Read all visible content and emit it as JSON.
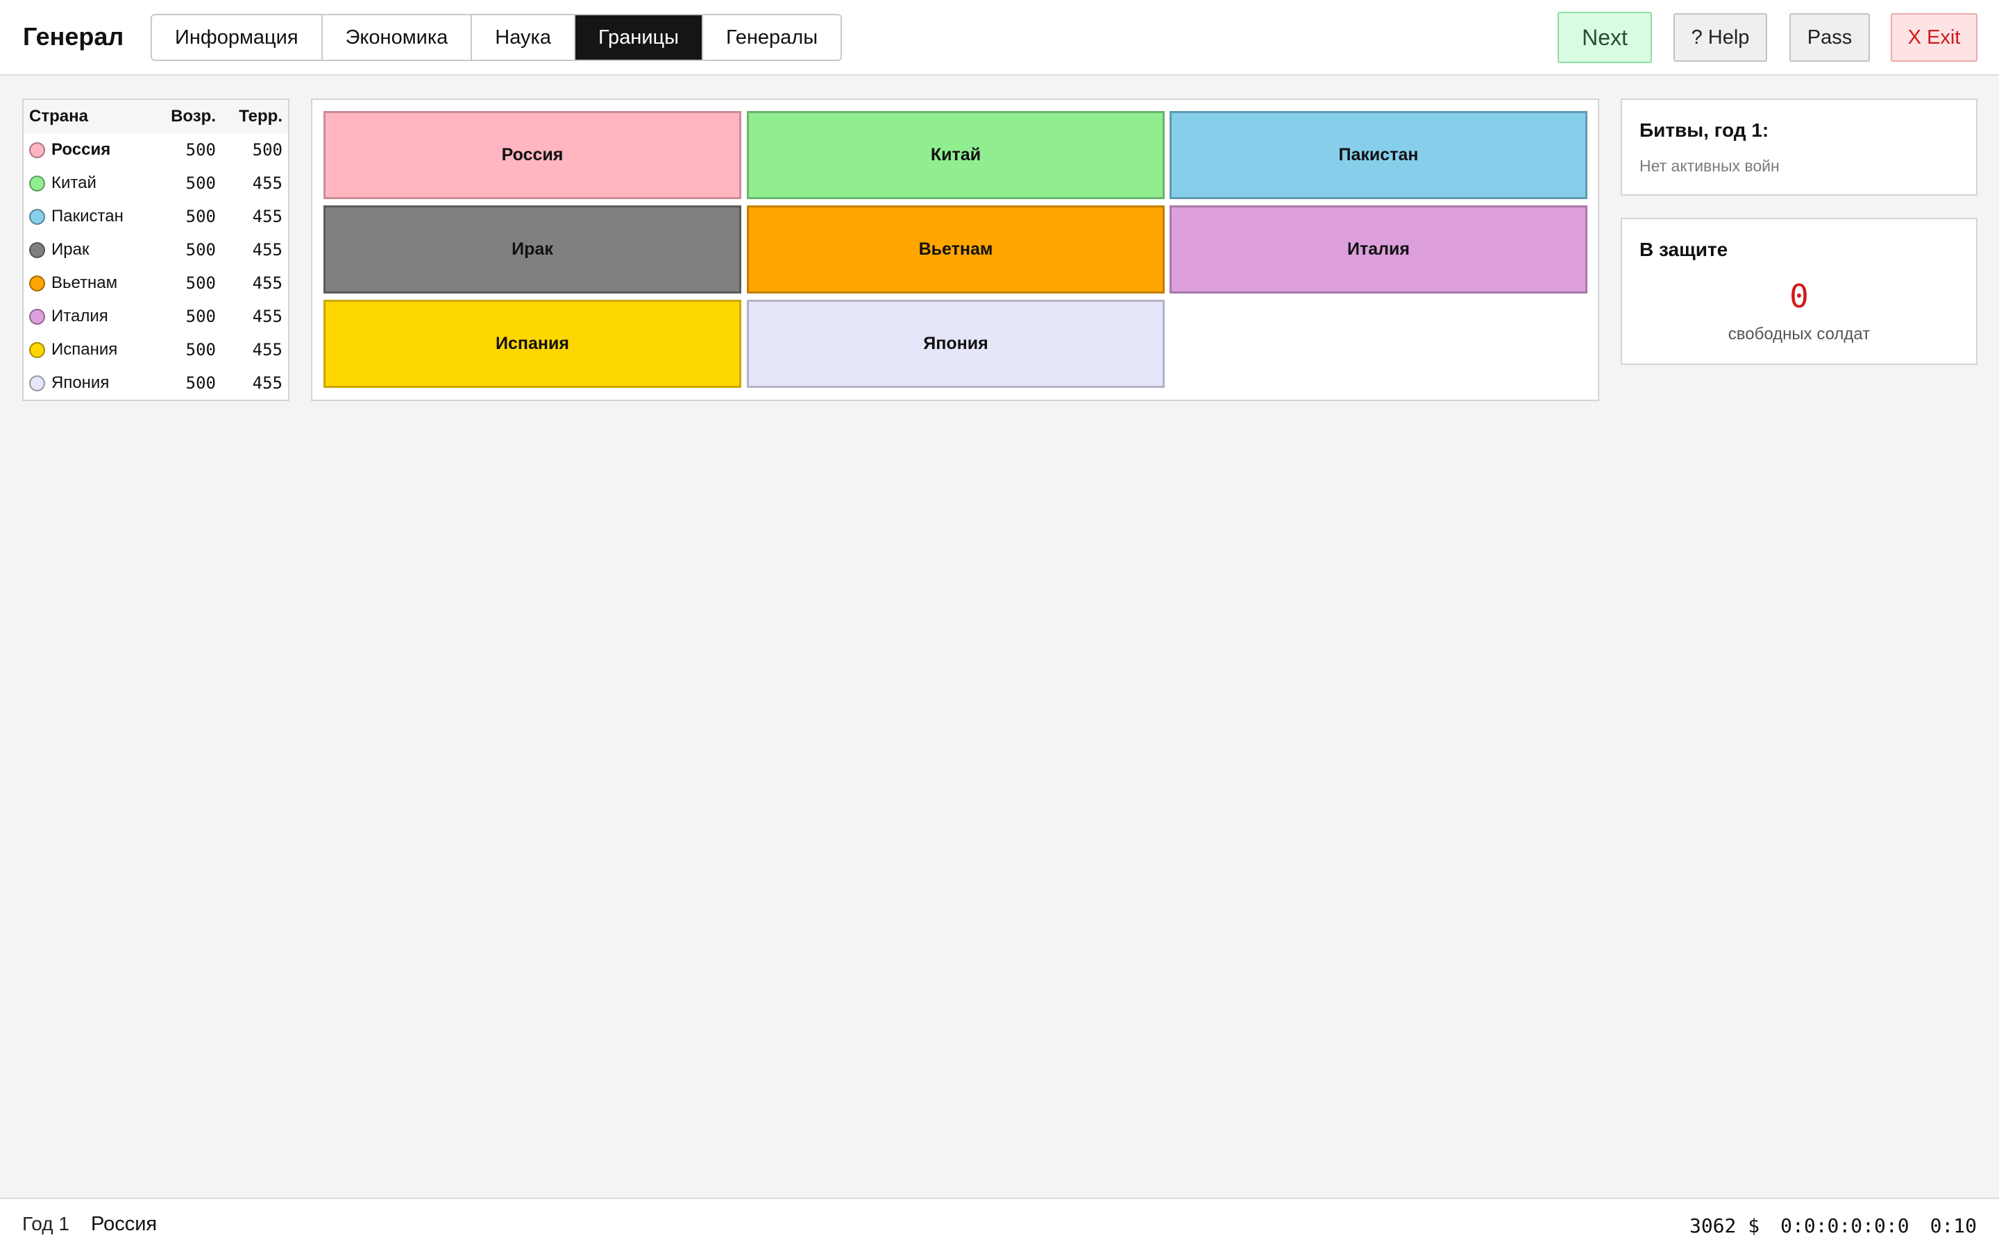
{
  "app": {
    "title": "Генерал"
  },
  "tabs": [
    {
      "label": "Информация",
      "active": false
    },
    {
      "label": "Экономика",
      "active": false
    },
    {
      "label": "Наука",
      "active": false
    },
    {
      "label": "Границы",
      "active": true
    },
    {
      "label": "Генералы",
      "active": false
    }
  ],
  "buttons": {
    "next": "Next",
    "help": "? Help",
    "pass": "Pass",
    "exit": "X Exit"
  },
  "country_table": {
    "headers": {
      "name": "Страна",
      "age": "Возр.",
      "terr": "Терр."
    },
    "rows": [
      {
        "name": "Россия",
        "age": "500",
        "terr": "500",
        "color": "#ffb6c1",
        "current": true
      },
      {
        "name": "Китай",
        "age": "500",
        "terr": "455",
        "color": "#90ee90",
        "current": false
      },
      {
        "name": "Пакистан",
        "age": "500",
        "terr": "455",
        "color": "#87ceeb",
        "current": false
      },
      {
        "name": "Ирак",
        "age": "500",
        "terr": "455",
        "color": "#808080",
        "current": false
      },
      {
        "name": "Вьетнам",
        "age": "500",
        "terr": "455",
        "color": "#ffa500",
        "current": false
      },
      {
        "name": "Италия",
        "age": "500",
        "terr": "455",
        "color": "#dda0dd",
        "current": false
      },
      {
        "name": "Испания",
        "age": "500",
        "terr": "455",
        "color": "#ffd700",
        "current": false
      },
      {
        "name": "Япония",
        "age": "500",
        "terr": "455",
        "color": "#e6e6fa",
        "current": false
      }
    ]
  },
  "map": {
    "tiles": [
      {
        "name": "Россия",
        "color": "#ffb6c1",
        "border": "#c98e98"
      },
      {
        "name": "Китай",
        "color": "#90ee90",
        "border": "#6cb56c"
      },
      {
        "name": "Пакистан",
        "color": "#87ceeb",
        "border": "#5f9ab3"
      },
      {
        "name": "Ирак",
        "color": "#808080",
        "border": "#5a5a5a"
      },
      {
        "name": "Вьетнам",
        "color": "#ffa500",
        "border": "#c47f00"
      },
      {
        "name": "Италия",
        "color": "#dda0dd",
        "border": "#a878a8"
      },
      {
        "name": "Испания",
        "color": "#ffd700",
        "border": "#c9a800"
      },
      {
        "name": "Япония",
        "color": "#e6e6fa",
        "border": "#b3b3c6"
      }
    ]
  },
  "battles": {
    "title": "Битвы, год 1:",
    "empty_text": "Нет активных войн"
  },
  "defense": {
    "title": "В защите",
    "value": "0",
    "caption": "свободных солдат"
  },
  "status": {
    "year": "Год 1",
    "country": "Россия",
    "money": "3062 $",
    "counters": "0:0:0:0:0:0",
    "time": "0:10"
  }
}
